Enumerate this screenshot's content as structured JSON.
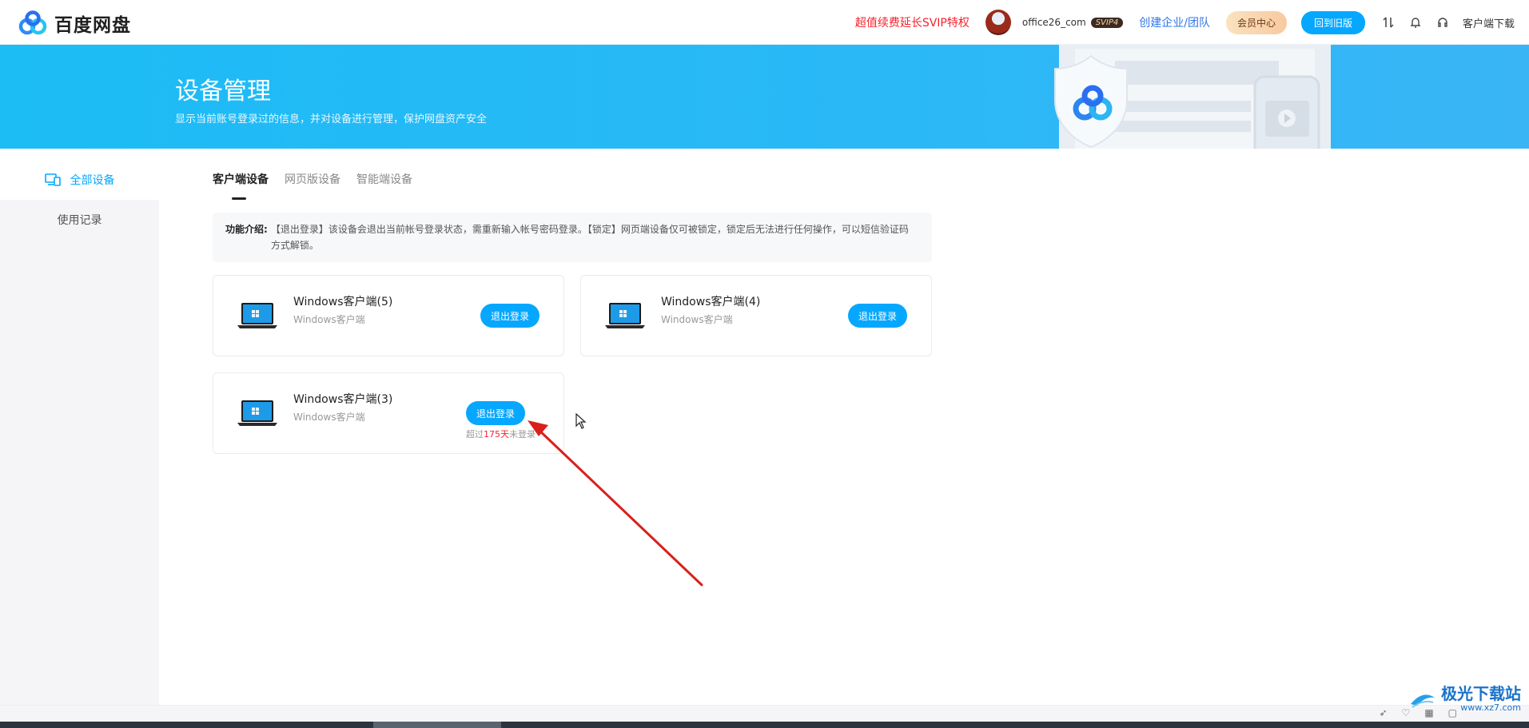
{
  "header": {
    "logo_text": "百度网盘",
    "promo": "超值续费延长SVIP特权",
    "username": "office26_com",
    "vip_badge": "SVIP4",
    "enterprise": "创建企业/团队",
    "member_center": "会员中心",
    "old_version": "回到旧版",
    "client_download": "客户端下载"
  },
  "banner": {
    "title": "设备管理",
    "subtitle": "显示当前账号登录过的信息，并对设备进行管理，保护网盘资产安全"
  },
  "sidebar": {
    "items": [
      {
        "label": "全部设备",
        "active": true
      },
      {
        "label": "使用记录",
        "active": false
      }
    ]
  },
  "tabs": [
    {
      "label": "客户端设备",
      "active": true
    },
    {
      "label": "网页版设备",
      "active": false
    },
    {
      "label": "智能端设备",
      "active": false
    }
  ],
  "notice": {
    "label": "功能介绍:",
    "text": "【退出登录】该设备会退出当前帐号登录状态，需重新输入帐号密码登录。【锁定】网页端设备仅可被锁定，锁定后无法进行任何操作，可以短信验证码方式解锁。"
  },
  "devices": [
    {
      "name": "Windows客户端(5)",
      "type": "Windows客户端",
      "button": "退出登录"
    },
    {
      "name": "Windows客户端(4)",
      "type": "Windows客户端",
      "button": "退出登录"
    },
    {
      "name": "Windows客户端(3)",
      "type": "Windows客户端",
      "button": "退出登录",
      "note_prefix": "超过",
      "note_days": "175天",
      "note_suffix": "未登录"
    }
  ],
  "watermark": {
    "text": "极光下载站",
    "url": "www.xz7.com"
  },
  "colors": {
    "accent": "#06a7ff",
    "promo": "#f5222d",
    "banner": "#1cbcf5",
    "annotation_arrow": "#d9201c"
  }
}
